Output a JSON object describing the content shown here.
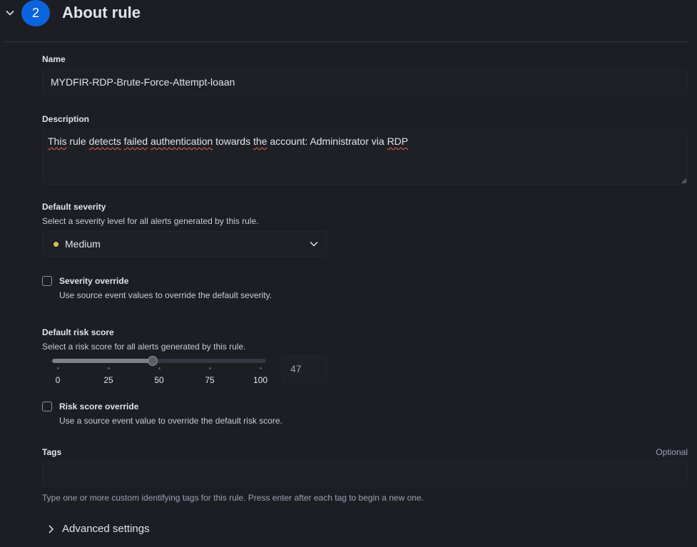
{
  "header": {
    "step_number": "2",
    "title": "About rule"
  },
  "name_field": {
    "label": "Name",
    "value": "MYDFIR-RDP-Brute-Force-Attempt-loaan"
  },
  "description_field": {
    "label": "Description",
    "words": [
      "This",
      "rule",
      "detects",
      "failed",
      "authentication",
      "towards",
      "the",
      "account:",
      "Administrator",
      "via",
      "RDP"
    ],
    "misspelled_flags": [
      true,
      false,
      true,
      true,
      true,
      false,
      true,
      false,
      false,
      false,
      true
    ]
  },
  "severity": {
    "label": "Default severity",
    "help": "Select a severity level for all alerts generated by this rule.",
    "selected": "Medium",
    "dot_color": "#d6bf57"
  },
  "severity_override": {
    "label": "Severity override",
    "help": "Use source event values to override the default severity.",
    "checked": false
  },
  "risk_score": {
    "label": "Default risk score",
    "help": "Select a risk score for all alerts generated by this rule.",
    "value": 47,
    "value_display": "47",
    "min": 0,
    "max": 100,
    "ticks": [
      "0",
      "25",
      "50",
      "75",
      "100"
    ]
  },
  "risk_override": {
    "label": "Risk score override",
    "help": "Use a source event value to override the default risk score.",
    "checked": false
  },
  "tags": {
    "label": "Tags",
    "optional": "Optional",
    "help": "Type one or more custom identifying tags for this rule. Press enter after each tag to begin a new one."
  },
  "advanced": {
    "label": "Advanced settings"
  },
  "colors": {
    "accent": "#0b64dd",
    "background": "#1d1e24"
  }
}
